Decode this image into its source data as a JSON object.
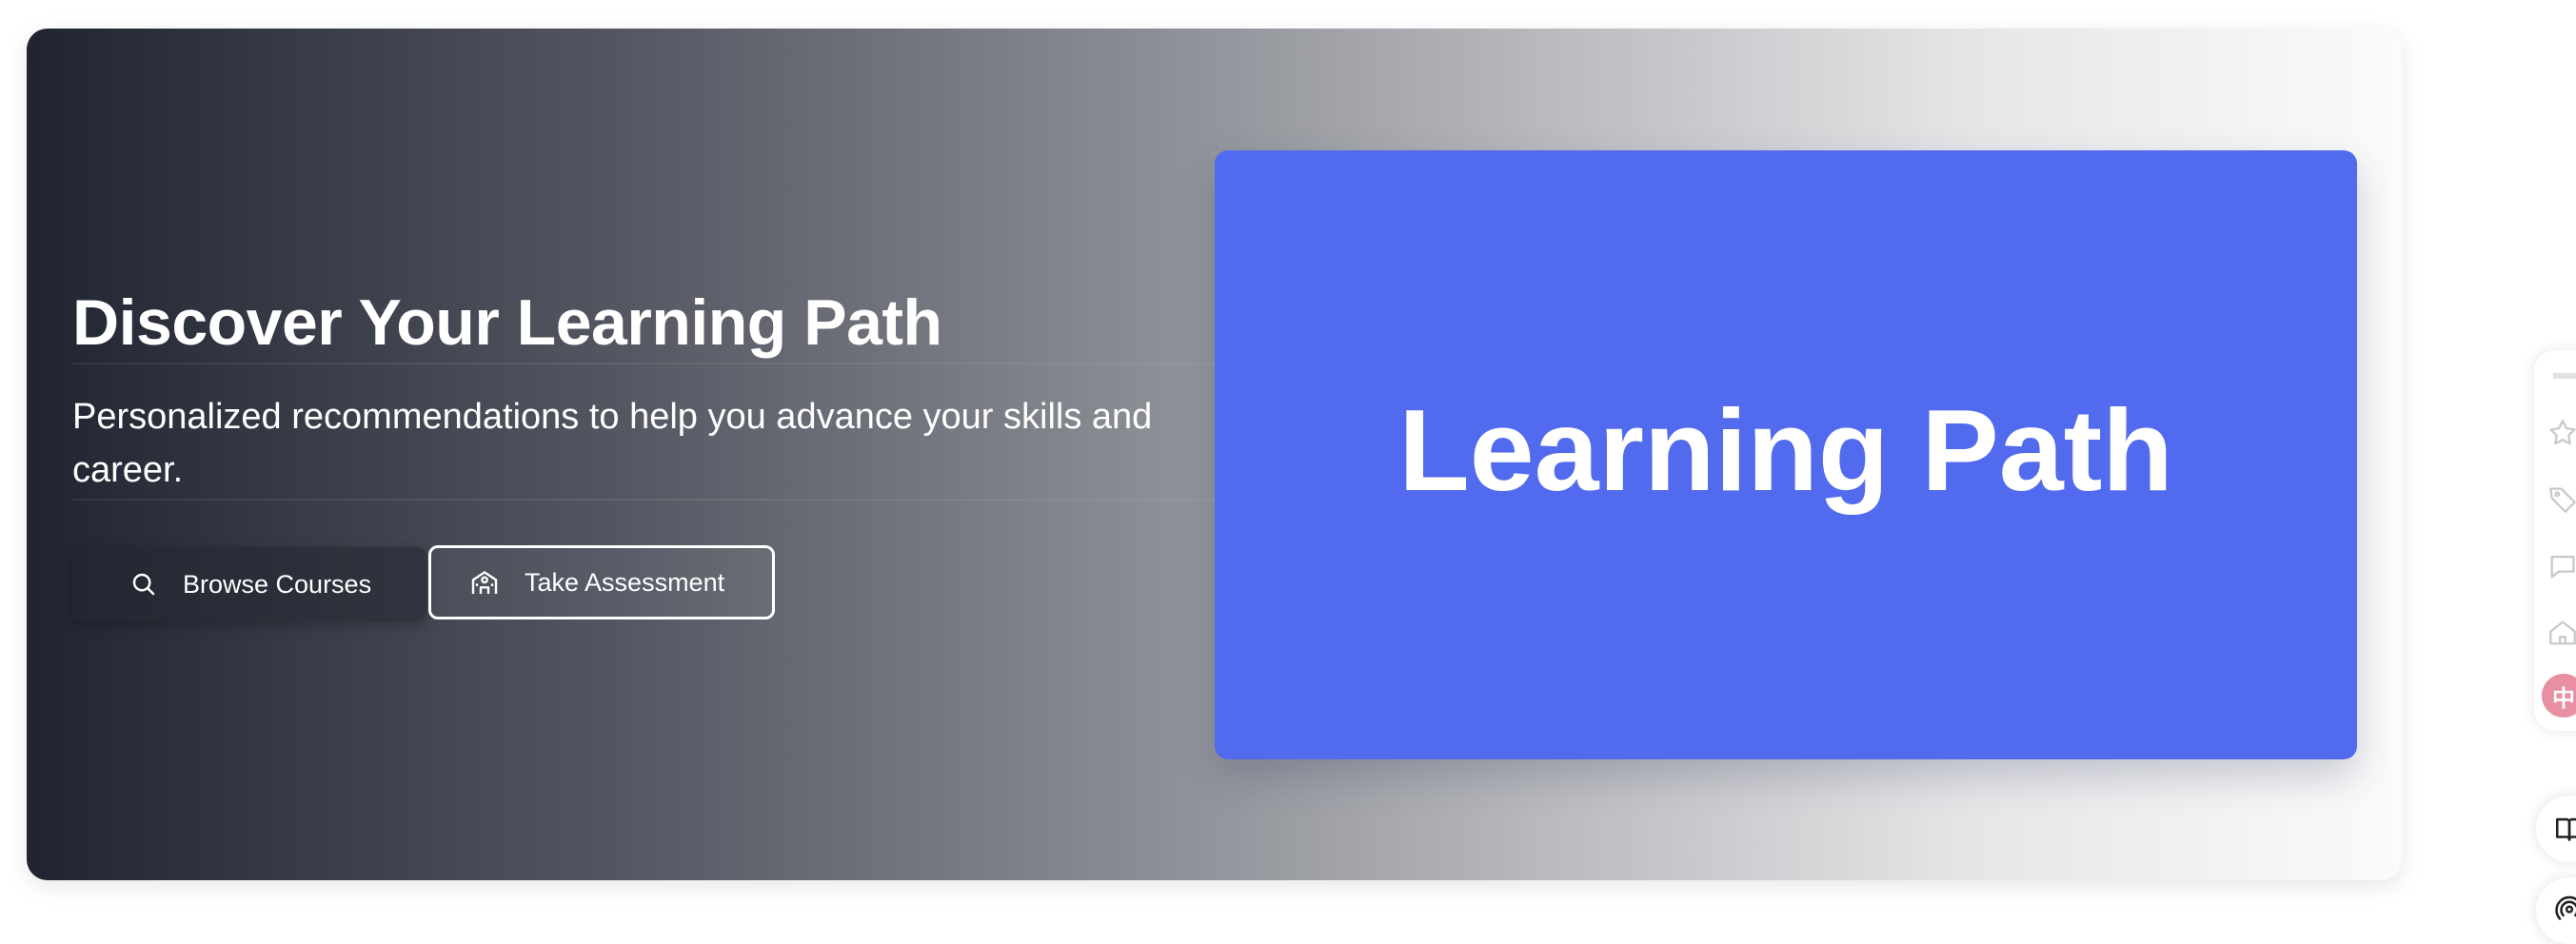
{
  "hero": {
    "title": "Discover Your Learning Path",
    "subtitle": "Personalized recommendations to help you advance your skills and career.",
    "buttons": {
      "browse_label": "Browse Courses",
      "assessment_label": "Take Assessment"
    },
    "card_text": "Learning Path",
    "gradient_colors": [
      "#1f2430",
      "#8a8d94",
      "#fbfbfb"
    ]
  },
  "side_toolbar": {
    "icons": [
      "star-icon",
      "tag-icon",
      "comment-icon",
      "home-icon"
    ],
    "language_badge": "中",
    "floating_buttons": [
      "book-icon",
      "podcast-icon"
    ]
  },
  "colors": {
    "card_blue": "#516aee",
    "badge_pink": "#e98fa2"
  }
}
